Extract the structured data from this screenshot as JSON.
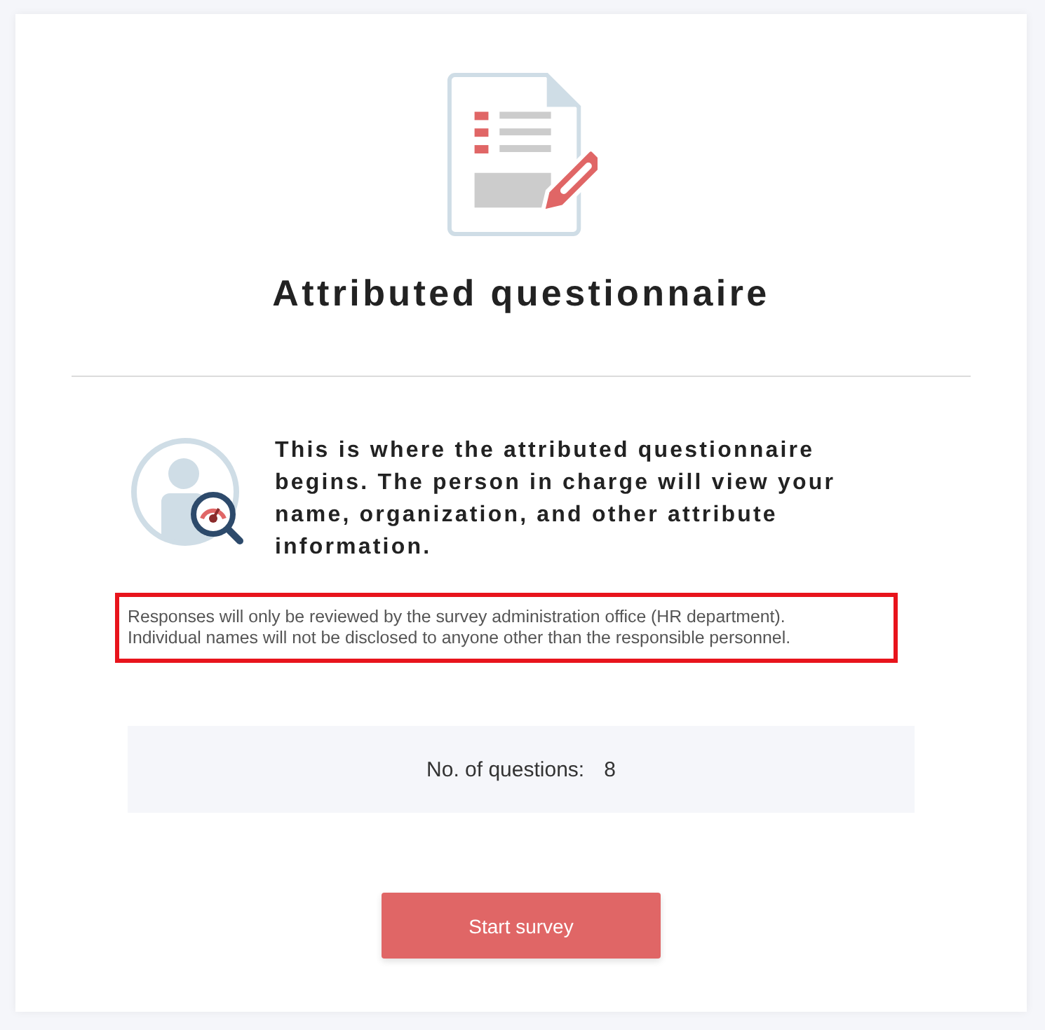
{
  "header": {
    "title": "Attributed questionnaire"
  },
  "intro": {
    "heading": "This is where the attributed questionnaire begins. The person in charge will view your name, organization, and other attribute information.",
    "notice": {
      "highlighted": true,
      "lines": [
        "Responses will only be reviewed by the survey administration office (HR department).",
        "Individual names will not be disclosed to anyone other than the responsible personnel."
      ]
    }
  },
  "summary": {
    "label": "No. of questions:",
    "value": "8"
  },
  "buttons": [
    {
      "label": "Start survey",
      "kind": "primary"
    }
  ]
}
